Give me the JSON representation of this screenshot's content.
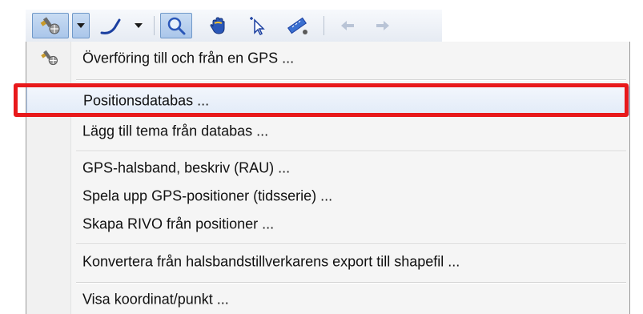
{
  "toolbar": {
    "buttons": [
      {
        "icon": "gps-satellite-icon",
        "pressed": true
      },
      {
        "icon": "chevron-down-icon"
      },
      {
        "icon": "pen-line-icon"
      },
      {
        "icon": "chevron-down-icon"
      },
      {
        "icon": "zoom-magnifier-icon",
        "pressed": true
      },
      {
        "icon": "pan-hand-icon"
      },
      {
        "icon": "select-arrow-icon"
      },
      {
        "icon": "measure-ruler-icon"
      },
      {
        "icon": "back-arrow-icon",
        "disabled": true
      },
      {
        "icon": "forward-arrow-icon",
        "disabled": true
      }
    ]
  },
  "menu": {
    "items": [
      {
        "label": "Överföring till och från en GPS ...",
        "icon": "gps-satellite-icon"
      },
      {
        "label": "Positionsdatabas ...",
        "highlighted": true
      },
      {
        "label": "Lägg till tema från databas ..."
      },
      {
        "label": "GPS-halsband, beskriv (RAU) ..."
      },
      {
        "label": "Spela upp GPS-positioner (tidsserie) ..."
      },
      {
        "label": "Skapa RIVO från positioner ..."
      },
      {
        "label": "Konvertera från halsbandstillverkarens export till shapefil ..."
      },
      {
        "label": "Visa koordinat/punkt ..."
      }
    ]
  },
  "colors": {
    "highlight_border": "#e8191b",
    "hover_fill": "#e2ebf8",
    "menu_bg": "#f5f5f5"
  }
}
